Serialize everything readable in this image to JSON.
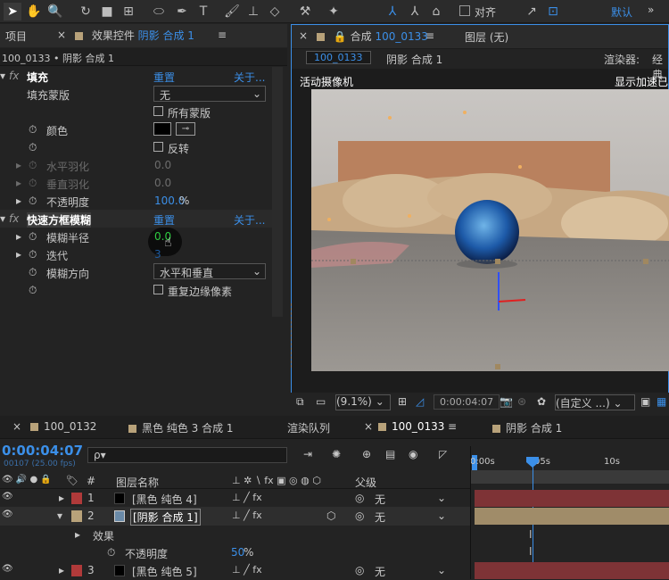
{
  "toolbar": {
    "align_label": "对齐",
    "default_label": "默认"
  },
  "left_panel": {
    "project_tab": "项目",
    "effects_tab_prefix": "效果控件",
    "effects_tab_name": "阴影 合成 1",
    "breadcrumb": "100_0133 • 阴影 合成 1",
    "effects": [
      {
        "name": "填充",
        "reset": "重置",
        "about": "关于..."
      },
      {
        "name": "快速方框模糊",
        "reset": "重置",
        "about": "关于..."
      }
    ],
    "fill_mask_label": "填充蒙版",
    "fill_mask_value": "无",
    "all_masks": "所有蒙版",
    "color_label": "颜色",
    "invert_label": "反转",
    "h_feather_label": "水平羽化",
    "h_feather_value": "0.0",
    "v_feather_label": "垂直羽化",
    "v_feather_value": "0.0",
    "opacity_label": "不透明度",
    "opacity_value": "100.0",
    "opacity_unit": "%",
    "blur_radius_label": "模糊半径",
    "blur_radius_value": "0.0",
    "iterations_label": "迭代",
    "iterations_value": "3",
    "blur_dir_label": "模糊方向",
    "blur_dir_value": "水平和垂直",
    "repeat_edge_label": "重复边缘像素"
  },
  "right_panel": {
    "comp_tab_prefix": "合成",
    "comp_tab_name": "100_0133",
    "layer_tab": "图层 (无)",
    "crumb_comp": "100_0133",
    "crumb_sub": "阴影 合成 1",
    "renderer_label": "渲染器:",
    "renderer_value": "经典",
    "camera_label": "活动摄像机",
    "accel_label": "显示加速已",
    "zoom_value": "(9.1%)",
    "timecode": "0:00:04:07",
    "view_option": "(自定义 ...)"
  },
  "timeline": {
    "tabs": [
      "100_0132",
      "黑色 纯色 3 合成 1",
      "渲染队列",
      "100_0133",
      "阴影 合成 1"
    ],
    "timecode": "0:00:04:07",
    "fps_label": "00107 (25.00 fps)",
    "search_placeholder": "ρ▾",
    "col_hash": "#",
    "col_layer_name": "图层名称",
    "col_parent": "父级",
    "ruler_marks": [
      "0:00s",
      "05s",
      "10s"
    ],
    "layers": [
      {
        "num": "1",
        "name": "[黑色 纯色 4]",
        "parent": "无",
        "color": "#b03a3a"
      },
      {
        "num": "2",
        "name": "[阴影 合成 1]",
        "parent": "无",
        "color": "#b8a27a"
      },
      {
        "num": "3",
        "name": "[黑色 纯色 5]",
        "parent": "无",
        "color": "#b03a3a"
      }
    ],
    "effects_label": "效果",
    "opacity_label": "不透明度",
    "opacity_value": "50",
    "opacity_unit": "%"
  }
}
